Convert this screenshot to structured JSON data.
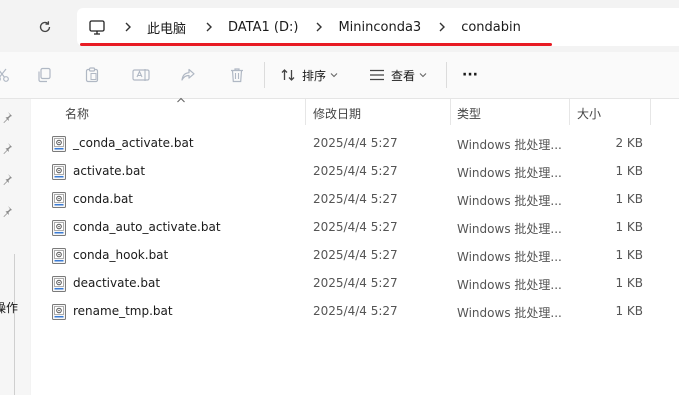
{
  "breadcrumb": [
    "此电脑",
    "DATA1 (D:)",
    "Mininconda3",
    "condabin"
  ],
  "toolbar": {
    "sort_label": "排序",
    "view_label": "查看",
    "more_label": "···"
  },
  "nav": {
    "partial_label": "操作"
  },
  "columns": {
    "name": "名称",
    "date": "修改日期",
    "type": "类型",
    "size": "大小"
  },
  "files": [
    {
      "name": "_conda_activate.bat",
      "date": "2025/4/4 5:27",
      "type": "Windows 批处理...",
      "size": "2 KB"
    },
    {
      "name": "activate.bat",
      "date": "2025/4/4 5:27",
      "type": "Windows 批处理...",
      "size": "1 KB"
    },
    {
      "name": "conda.bat",
      "date": "2025/4/4 5:27",
      "type": "Windows 批处理...",
      "size": "1 KB"
    },
    {
      "name": "conda_auto_activate.bat",
      "date": "2025/4/4 5:27",
      "type": "Windows 批处理...",
      "size": "1 KB"
    },
    {
      "name": "conda_hook.bat",
      "date": "2025/4/4 5:27",
      "type": "Windows 批处理...",
      "size": "1 KB"
    },
    {
      "name": "deactivate.bat",
      "date": "2025/4/4 5:27",
      "type": "Windows 批处理...",
      "size": "1 KB"
    },
    {
      "name": "rename_tmp.bat",
      "date": "2025/4/4 5:27",
      "type": "Windows 批处理...",
      "size": "1 KB"
    }
  ],
  "colors": {
    "annotation": "#e81b23",
    "icon": "#6b6b6b",
    "accent_blue": "#3a7bd5"
  },
  "icons": {
    "toolbar": [
      "cut-icon",
      "copy-icon",
      "paste-icon",
      "rename-icon",
      "share-icon",
      "delete-icon",
      "sort-icon",
      "view-icon"
    ],
    "address": [
      "refresh-icon",
      "computer-icon",
      "chevron-right-icon"
    ],
    "file": "batch-file-icon"
  }
}
